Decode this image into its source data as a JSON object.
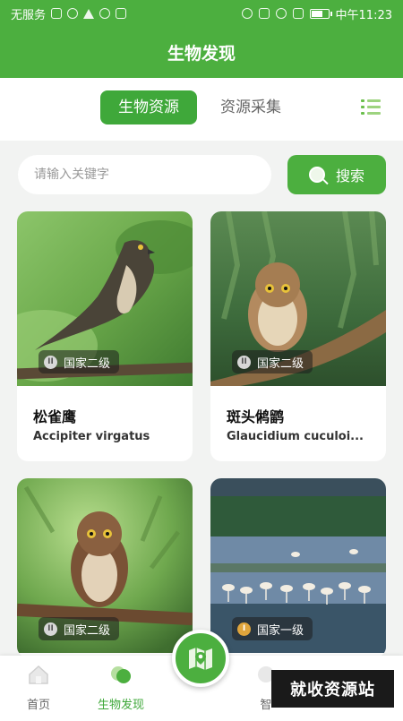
{
  "status_bar": {
    "carrier": "无服务",
    "time": "中午11:23"
  },
  "header": {
    "title": "生物发现"
  },
  "tabs": [
    {
      "label": "生物资源",
      "active": true
    },
    {
      "label": "资源采集",
      "active": false
    }
  ],
  "search": {
    "placeholder": "请输入关键字",
    "button_label": "搜索"
  },
  "cards": [
    {
      "name": "松雀鹰",
      "latin": "Accipiter virgatus",
      "badge_label": "国家二级",
      "badge_icon": "II"
    },
    {
      "name": "斑头鸺鹠",
      "latin": "Glaucidium cuculoi...",
      "badge_label": "国家二级",
      "badge_icon": "II"
    },
    {
      "name": "",
      "latin": "",
      "badge_label": "国家二级",
      "badge_icon": "II"
    },
    {
      "name": "",
      "latin": "",
      "badge_label": "国家一级",
      "badge_icon": "I"
    }
  ],
  "bottom_nav": [
    {
      "label": "首页",
      "icon": "home-icon",
      "active": false
    },
    {
      "label": "生物发现",
      "icon": "discovery-icon",
      "active": true
    },
    {
      "label": "智",
      "icon": "smart-icon",
      "active": false
    }
  ],
  "watermark": "就收资源站",
  "colors": {
    "primary": "#4caf3f",
    "tab_active": "#3fa83a",
    "background": "#f2f3f2"
  }
}
